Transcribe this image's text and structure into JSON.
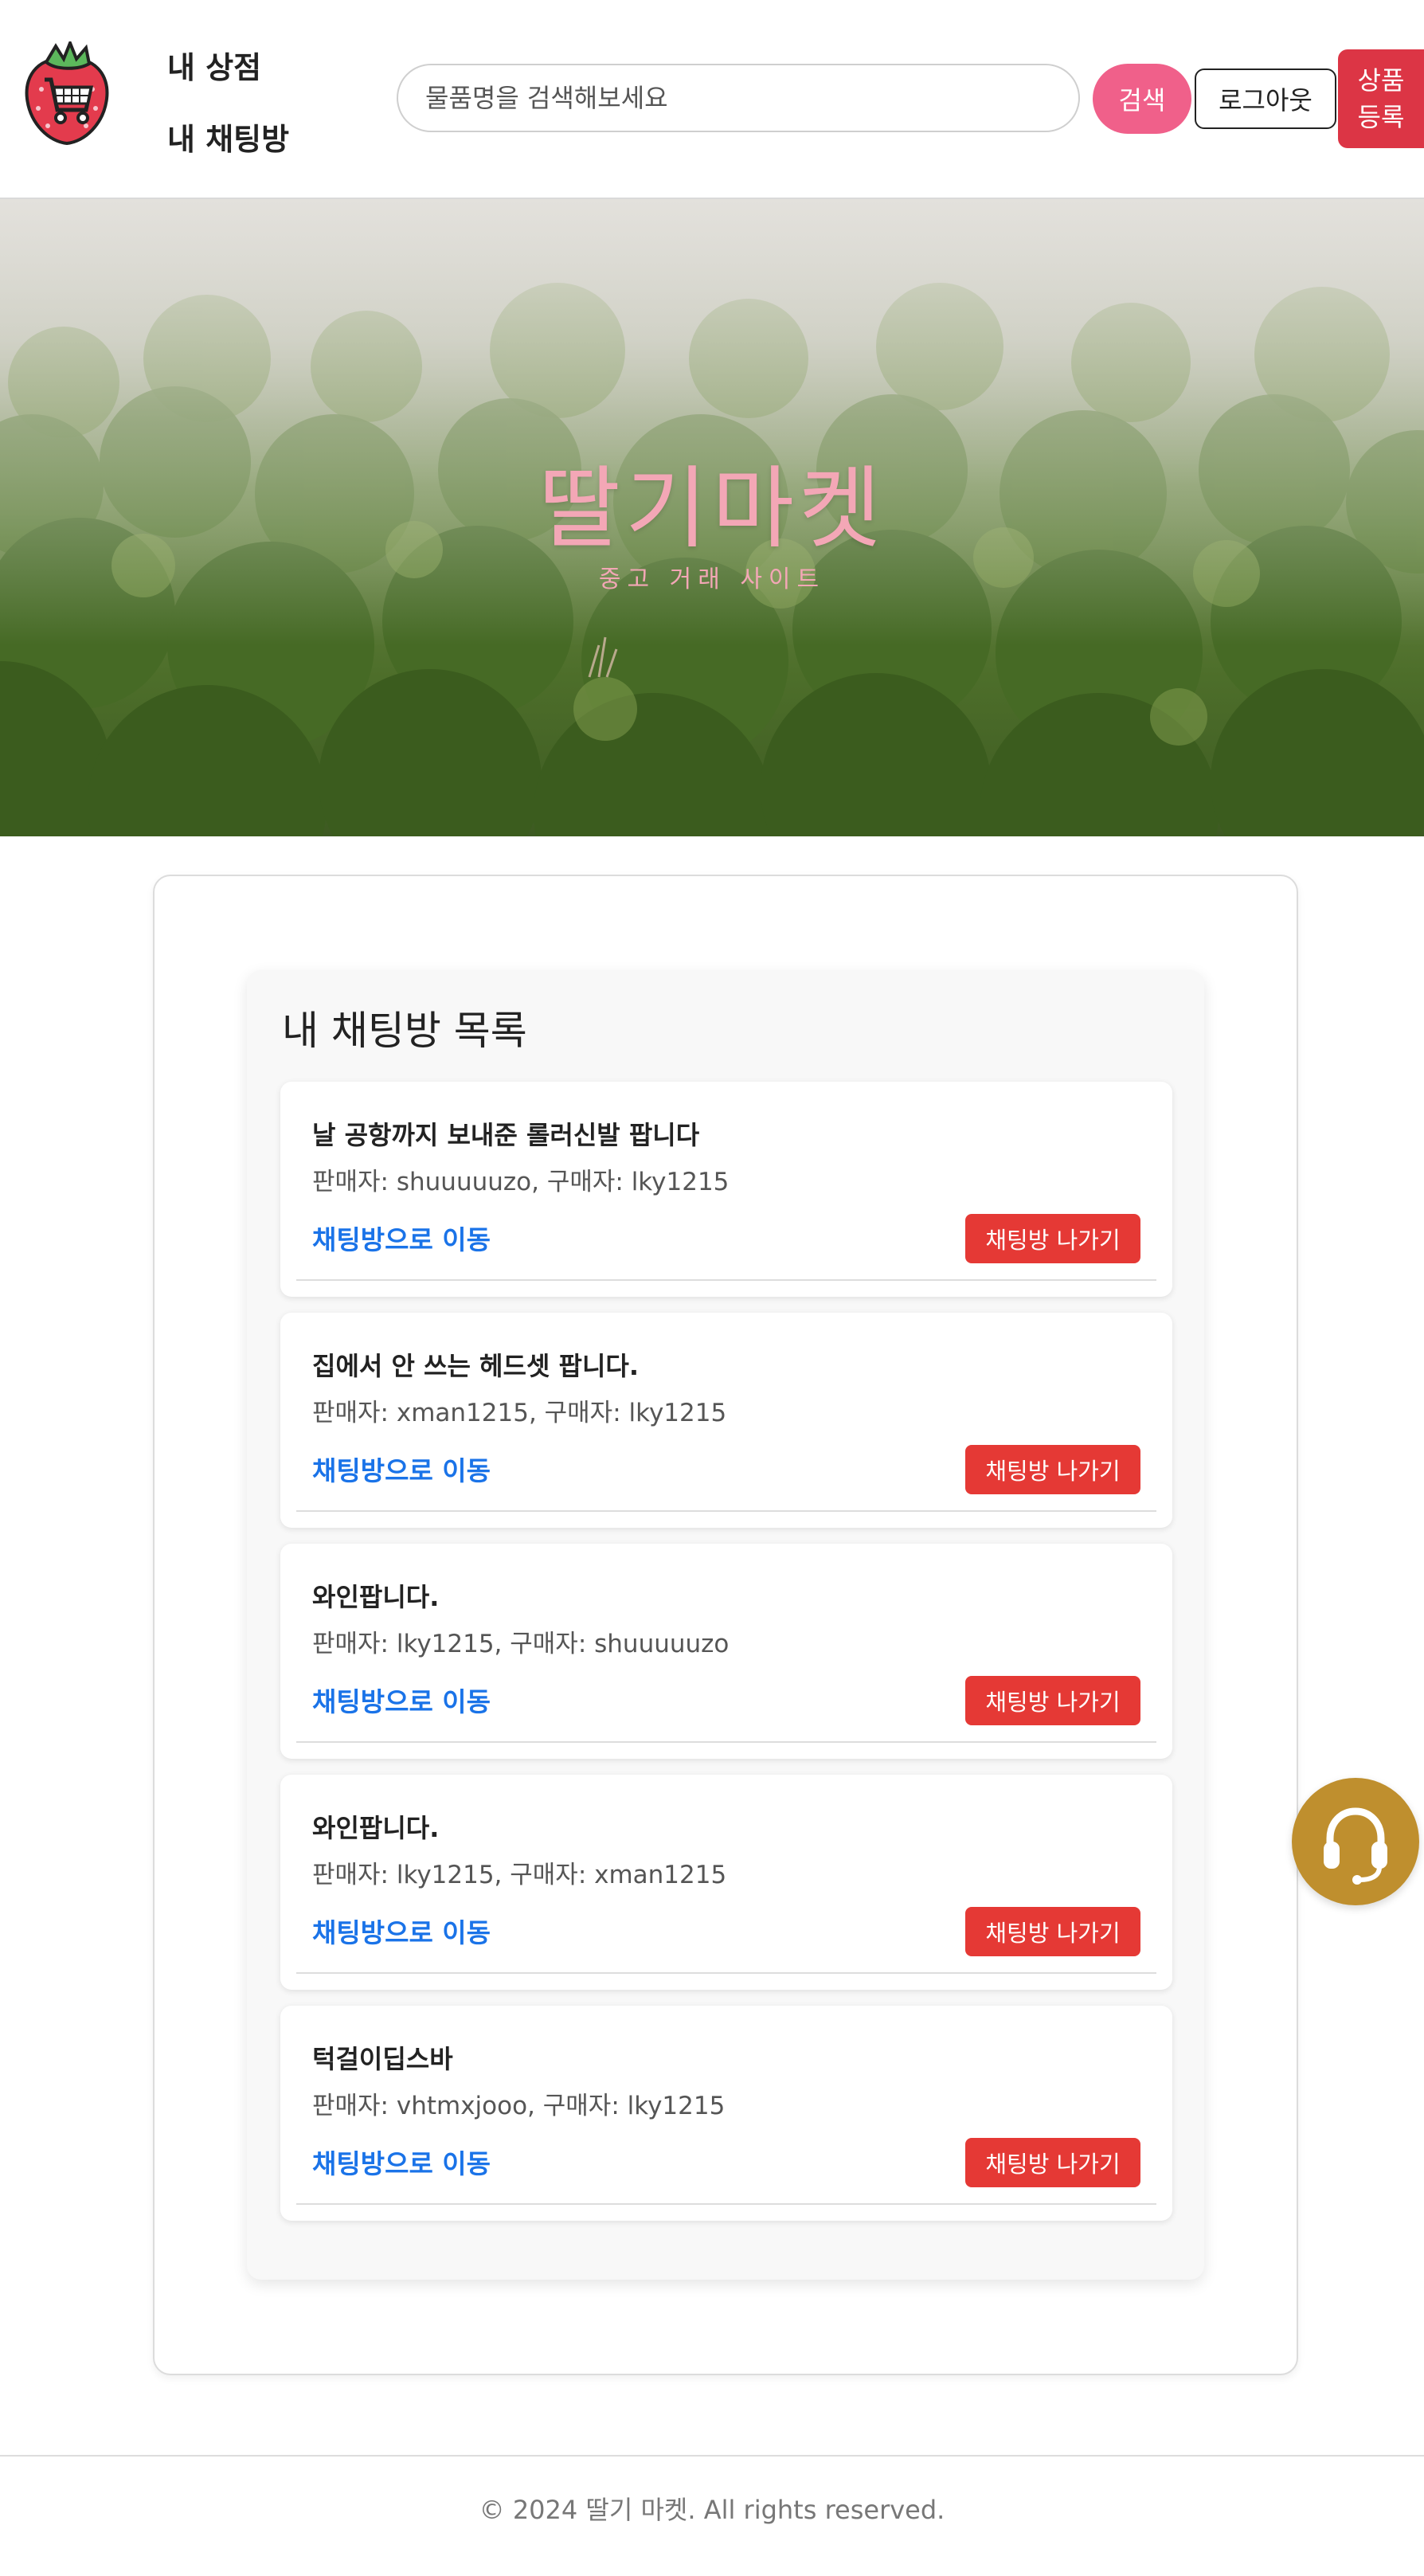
{
  "header": {
    "nav": {
      "my_shop": "내 상점",
      "my_chatrooms": "내 채팅방"
    },
    "search": {
      "placeholder": "물품명을 검색해보세요",
      "button": "검색"
    },
    "logout_label": "로그아웃",
    "register_label": "상품 등록"
  },
  "hero": {
    "title": "딸기마켓",
    "subtitle": "중고 거래 사이트"
  },
  "chat_list": {
    "title": "내 채팅방 목록",
    "rooms": [
      {
        "title": "날 공항까지 보내준 롤러신발 팝니다",
        "people": "판매자: shuuuuuzo, 구매자: lky1215",
        "link": "채팅방으로 이동",
        "leave": "채팅방 나가기"
      },
      {
        "title": "집에서 안 쓰는 헤드셋 팝니다.",
        "people": "판매자: xman1215, 구매자: lky1215",
        "link": "채팅방으로 이동",
        "leave": "채팅방 나가기"
      },
      {
        "title": "와인팝니다.",
        "people": "판매자: lky1215, 구매자: shuuuuuzo",
        "link": "채팅방으로 이동",
        "leave": "채팅방 나가기"
      },
      {
        "title": "와인팝니다.",
        "people": "판매자: lky1215, 구매자: xman1215",
        "link": "채팅방으로 이동",
        "leave": "채팅방 나가기"
      },
      {
        "title": "턱걸이딥스바",
        "people": "판매자: vhtmxjooo, 구매자: lky1215",
        "link": "채팅방으로 이동",
        "leave": "채팅방 나가기"
      }
    ]
  },
  "footer": {
    "copyright": "© 2024 딸기 마켓. All rights reserved."
  },
  "icons": {
    "logo": "strawberry-cart-logo",
    "support": "headset-icon"
  },
  "colors": {
    "accent_pink": "#f0608a",
    "danger_red": "#dc3545",
    "link_blue": "#1a73e8",
    "support_gold": "#bf8f2e",
    "hero_text": "#f3a7b6"
  }
}
